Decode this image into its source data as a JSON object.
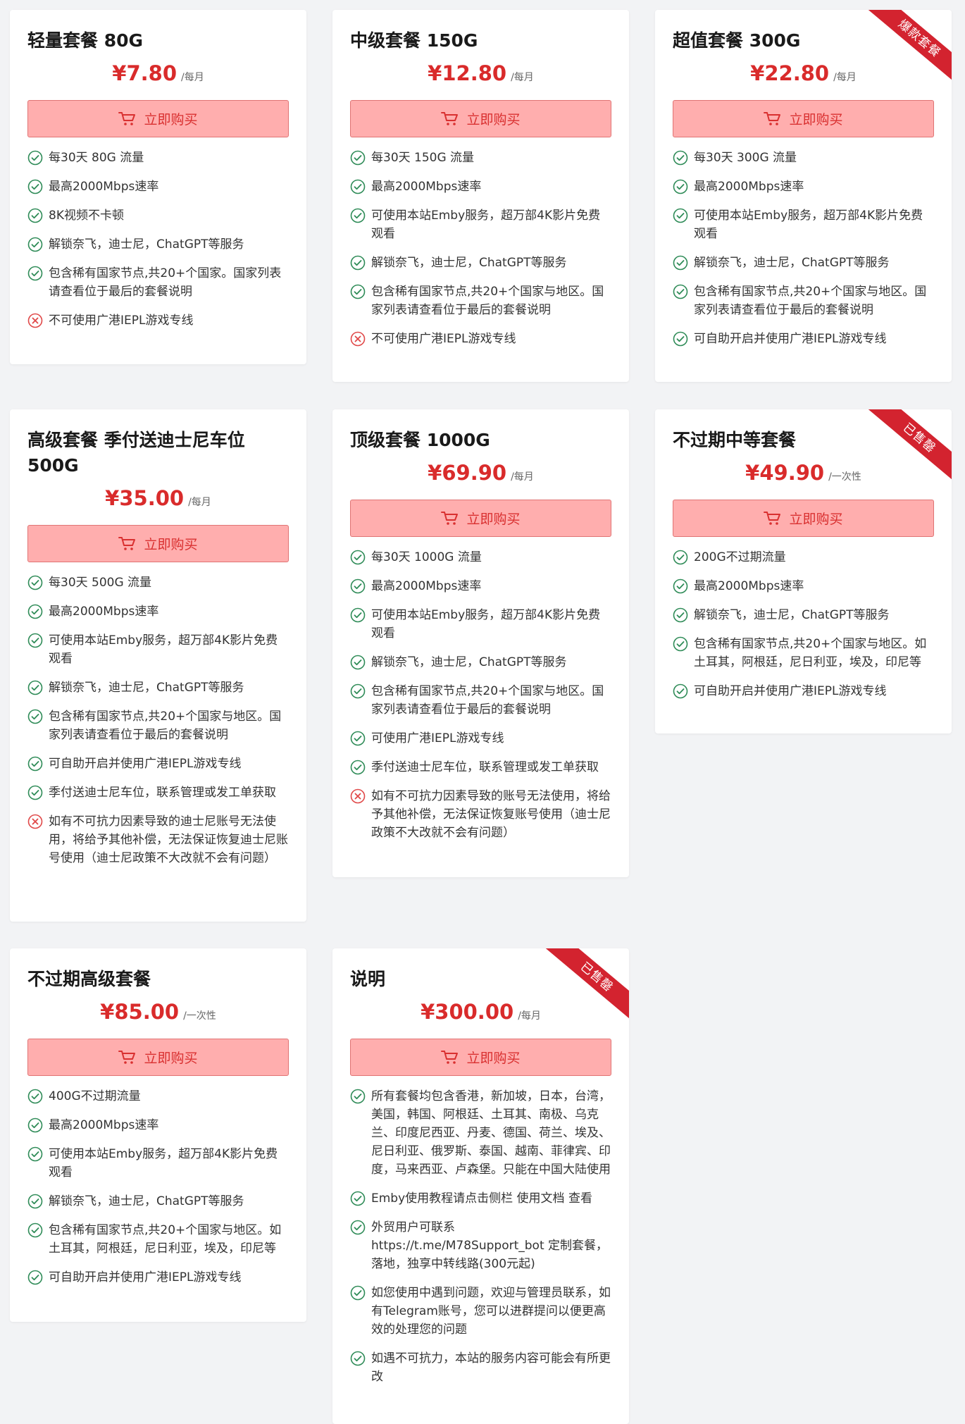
{
  "buy_label": "立即购买",
  "colors": {
    "accent": "#d92b2b",
    "button_bg": "#ffaeae",
    "check": "#2e8b57",
    "cross": "#e04848",
    "ribbon": "#d3232f"
  },
  "icons": {
    "cart": "cart-icon",
    "check": "check-circle-icon",
    "cross": "x-circle-icon"
  },
  "plans": [
    {
      "title": "轻量套餐 80G",
      "price": "¥7.80",
      "period": "/每月",
      "ribbon": "",
      "features": [
        {
          "ok": true,
          "text": "每30天 80G 流量"
        },
        {
          "ok": true,
          "text": "最高2000Mbps速率"
        },
        {
          "ok": true,
          "text": "8K视频不卡顿"
        },
        {
          "ok": true,
          "text": "解锁奈飞，迪士尼，ChatGPT等服务"
        },
        {
          "ok": true,
          "text": "包含稀有国家节点,共20+个国家。国家列表请查看位于最后的套餐说明"
        },
        {
          "ok": false,
          "text": "不可使用广港IEPL游戏专线"
        }
      ]
    },
    {
      "title": "中级套餐 150G",
      "price": "¥12.80",
      "period": "/每月",
      "ribbon": "",
      "features": [
        {
          "ok": true,
          "text": "每30天 150G 流量"
        },
        {
          "ok": true,
          "text": "最高2000Mbps速率"
        },
        {
          "ok": true,
          "text": "可使用本站Emby服务，超万部4K影片免费观看"
        },
        {
          "ok": true,
          "text": "解锁奈飞，迪士尼，ChatGPT等服务"
        },
        {
          "ok": true,
          "text": "包含稀有国家节点,共20+个国家与地区。国家列表请查看位于最后的套餐说明"
        },
        {
          "ok": false,
          "text": "不可使用广港IEPL游戏专线"
        }
      ]
    },
    {
      "title": "超值套餐 300G",
      "price": "¥22.80",
      "period": "/每月",
      "ribbon": "爆款套餐",
      "features": [
        {
          "ok": true,
          "text": "每30天 300G 流量"
        },
        {
          "ok": true,
          "text": "最高2000Mbps速率"
        },
        {
          "ok": true,
          "text": "可使用本站Emby服务，超万部4K影片免费观看"
        },
        {
          "ok": true,
          "text": "解锁奈飞，迪士尼，ChatGPT等服务"
        },
        {
          "ok": true,
          "text": "包含稀有国家节点,共20+个国家与地区。国家列表请查看位于最后的套餐说明"
        },
        {
          "ok": true,
          "text": "可自助开启并使用广港IEPL游戏专线"
        }
      ]
    },
    {
      "title": "高级套餐 季付送迪士尼车位 500G",
      "price": "¥35.00",
      "period": "/每月",
      "ribbon": "",
      "features": [
        {
          "ok": true,
          "text": "每30天 500G 流量"
        },
        {
          "ok": true,
          "text": "最高2000Mbps速率"
        },
        {
          "ok": true,
          "text": "可使用本站Emby服务，超万部4K影片免费观看"
        },
        {
          "ok": true,
          "text": "解锁奈飞，迪士尼，ChatGPT等服务"
        },
        {
          "ok": true,
          "text": "包含稀有国家节点,共20+个国家与地区。国家列表请查看位于最后的套餐说明"
        },
        {
          "ok": true,
          "text": "可自助开启并使用广港IEPL游戏专线"
        },
        {
          "ok": true,
          "text": "季付送迪士尼车位，联系管理或发工单获取"
        },
        {
          "ok": false,
          "text": "如有不可抗力因素导致的迪士尼账号无法使用，将给予其他补偿，无法保证恢复迪士尼账号使用（迪士尼政策不大改就不会有问题）"
        }
      ]
    },
    {
      "title": "顶级套餐 1000G",
      "price": "¥69.90",
      "period": "/每月",
      "ribbon": "",
      "features": [
        {
          "ok": true,
          "text": "每30天 1000G 流量"
        },
        {
          "ok": true,
          "text": "最高2000Mbps速率"
        },
        {
          "ok": true,
          "text": "可使用本站Emby服务，超万部4K影片免费观看"
        },
        {
          "ok": true,
          "text": "解锁奈飞，迪士尼，ChatGPT等服务"
        },
        {
          "ok": true,
          "text": "包含稀有国家节点,共20+个国家与地区。国家列表请查看位于最后的套餐说明"
        },
        {
          "ok": true,
          "text": "可使用广港IEPL游戏专线"
        },
        {
          "ok": true,
          "text": "季付送迪士尼车位，联系管理或发工单获取"
        },
        {
          "ok": false,
          "text": "如有不可抗力因素导致的账号无法使用，将给予其他补偿，无法保证恢复账号使用（迪士尼政策不大改就不会有问题）"
        }
      ]
    },
    {
      "title": "不过期中等套餐",
      "price": "¥49.90",
      "period": "/一次性",
      "ribbon": "已售罄",
      "features": [
        {
          "ok": true,
          "text": "200G不过期流量"
        },
        {
          "ok": true,
          "text": "最高2000Mbps速率"
        },
        {
          "ok": true,
          "text": "解锁奈飞，迪士尼，ChatGPT等服务"
        },
        {
          "ok": true,
          "text": "包含稀有国家节点,共20+个国家与地区。如土耳其，阿根廷，尼日利亚，埃及，印尼等"
        },
        {
          "ok": true,
          "text": "可自助开启并使用广港IEPL游戏专线"
        }
      ]
    },
    {
      "title": "不过期高级套餐",
      "price": "¥85.00",
      "period": "/一次性",
      "ribbon": "",
      "features": [
        {
          "ok": true,
          "text": "400G不过期流量"
        },
        {
          "ok": true,
          "text": "最高2000Mbps速率"
        },
        {
          "ok": true,
          "text": "可使用本站Emby服务，超万部4K影片免费观看"
        },
        {
          "ok": true,
          "text": "解锁奈飞，迪士尼，ChatGPT等服务"
        },
        {
          "ok": true,
          "text": "包含稀有国家节点,共20+个国家与地区。如土耳其，阿根廷，尼日利亚，埃及，印尼等"
        },
        {
          "ok": true,
          "text": "可自助开启并使用广港IEPL游戏专线"
        }
      ]
    },
    {
      "title": "说明",
      "price": "¥300.00",
      "period": "/每月",
      "ribbon": "已售罄",
      "features": [
        {
          "ok": true,
          "text": "所有套餐均包含香港，新加坡，日本，台湾，美国，韩国、阿根廷、土耳其、南极、乌克兰、印度尼西亚、丹麦、德国、荷兰、埃及、尼日利亚、俄罗斯、泰国、越南、菲律宾、印度，马来西亚、卢森堡。只能在中国大陆使用"
        },
        {
          "ok": true,
          "text": "Emby使用教程请点击侧栏 使用文档 查看"
        },
        {
          "ok": true,
          "text": "外贸用户可联系https://t.me/M78Support_bot 定制套餐，落地，独享中转线路(300元起)"
        },
        {
          "ok": true,
          "text": "如您使用中遇到问题，欢迎与管理员联系，如有Telegram账号，您可以进群提问以便更高效的处理您的问题"
        },
        {
          "ok": true,
          "text": "如遇不可抗力，本站的服务内容可能会有所更改"
        }
      ]
    }
  ]
}
